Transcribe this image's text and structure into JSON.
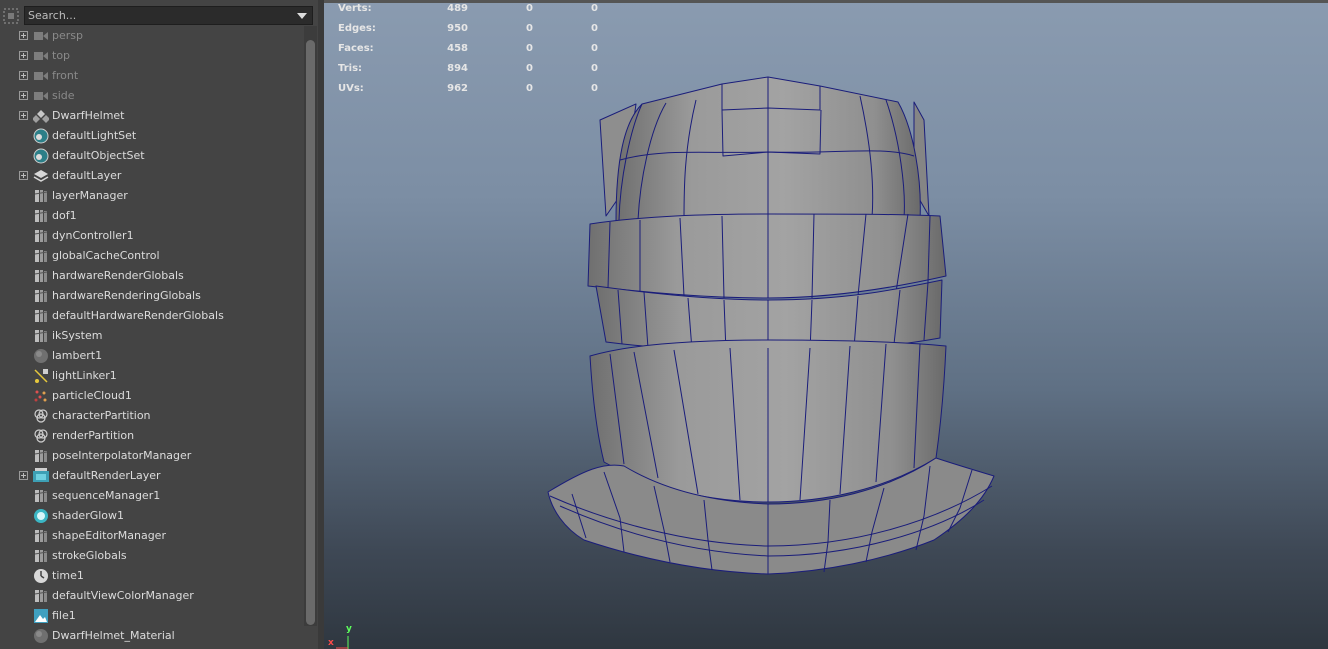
{
  "outliner": {
    "search_placeholder": "Search...",
    "items": [
      {
        "label": "persp",
        "icon": "camera-icon",
        "expandable": true,
        "dim": true
      },
      {
        "label": "top",
        "icon": "camera-icon",
        "expandable": true,
        "dim": true
      },
      {
        "label": "front",
        "icon": "camera-icon",
        "expandable": true,
        "dim": true
      },
      {
        "label": "side",
        "icon": "camera-icon",
        "expandable": true,
        "dim": true
      },
      {
        "label": "DwarfHelmet",
        "icon": "group-icon",
        "expandable": true,
        "dim": false
      },
      {
        "label": "defaultLightSet",
        "icon": "set-icon",
        "expandable": false,
        "dim": false
      },
      {
        "label": "defaultObjectSet",
        "icon": "set-icon",
        "expandable": false,
        "dim": false
      },
      {
        "label": "defaultLayer",
        "icon": "layer-icon",
        "expandable": true,
        "dim": false
      },
      {
        "label": "layerManager",
        "icon": "node-icon",
        "expandable": false,
        "dim": false
      },
      {
        "label": "dof1",
        "icon": "node-icon",
        "expandable": false,
        "dim": false
      },
      {
        "label": "dynController1",
        "icon": "node-icon",
        "expandable": false,
        "dim": false
      },
      {
        "label": "globalCacheControl",
        "icon": "node-icon",
        "expandable": false,
        "dim": false
      },
      {
        "label": "hardwareRenderGlobals",
        "icon": "node-icon",
        "expandable": false,
        "dim": false
      },
      {
        "label": "hardwareRenderingGlobals",
        "icon": "node-icon",
        "expandable": false,
        "dim": false
      },
      {
        "label": "defaultHardwareRenderGlobals",
        "icon": "node-icon",
        "expandable": false,
        "dim": false
      },
      {
        "label": "ikSystem",
        "icon": "node-icon",
        "expandable": false,
        "dim": false
      },
      {
        "label": "lambert1",
        "icon": "material-sphere-icon",
        "expandable": false,
        "dim": false
      },
      {
        "label": "lightLinker1",
        "icon": "light-linker-icon",
        "expandable": false,
        "dim": false
      },
      {
        "label": "particleCloud1",
        "icon": "particle-icon",
        "expandable": false,
        "dim": false
      },
      {
        "label": "characterPartition",
        "icon": "partition-icon",
        "expandable": false,
        "dim": false
      },
      {
        "label": "renderPartition",
        "icon": "partition-icon",
        "expandable": false,
        "dim": false
      },
      {
        "label": "poseInterpolatorManager",
        "icon": "node-icon",
        "expandable": false,
        "dim": false
      },
      {
        "label": "defaultRenderLayer",
        "icon": "render-layer-icon",
        "expandable": true,
        "dim": false
      },
      {
        "label": "sequenceManager1",
        "icon": "node-icon",
        "expandable": false,
        "dim": false
      },
      {
        "label": "shaderGlow1",
        "icon": "glow-icon",
        "expandable": false,
        "dim": false
      },
      {
        "label": "shapeEditorManager",
        "icon": "node-icon",
        "expandable": false,
        "dim": false
      },
      {
        "label": "strokeGlobals",
        "icon": "node-icon",
        "expandable": false,
        "dim": false
      },
      {
        "label": "time1",
        "icon": "clock-icon",
        "expandable": false,
        "dim": false
      },
      {
        "label": "defaultViewColorManager",
        "icon": "node-icon",
        "expandable": false,
        "dim": false
      },
      {
        "label": "file1",
        "icon": "image-file-icon",
        "expandable": false,
        "dim": false
      },
      {
        "label": "DwarfHelmet_Material",
        "icon": "material-sphere-icon",
        "expandable": false,
        "dim": false
      }
    ]
  },
  "hud": {
    "rows": [
      {
        "label": "Verts:",
        "v1": "489",
        "v2": "0",
        "v3": "0"
      },
      {
        "label": "Edges:",
        "v1": "950",
        "v2": "0",
        "v3": "0"
      },
      {
        "label": "Faces:",
        "v1": "458",
        "v2": "0",
        "v3": "0"
      },
      {
        "label": "Tris:",
        "v1": "894",
        "v2": "0",
        "v3": "0"
      },
      {
        "label": "UVs:",
        "v1": "962",
        "v2": "0",
        "v3": "0"
      }
    ]
  },
  "axis": {
    "y_label": "y",
    "x_label": "x"
  },
  "colors": {
    "wire": "#1a1d7a",
    "mesh": "#9b9b9b",
    "panel": "#444444"
  }
}
